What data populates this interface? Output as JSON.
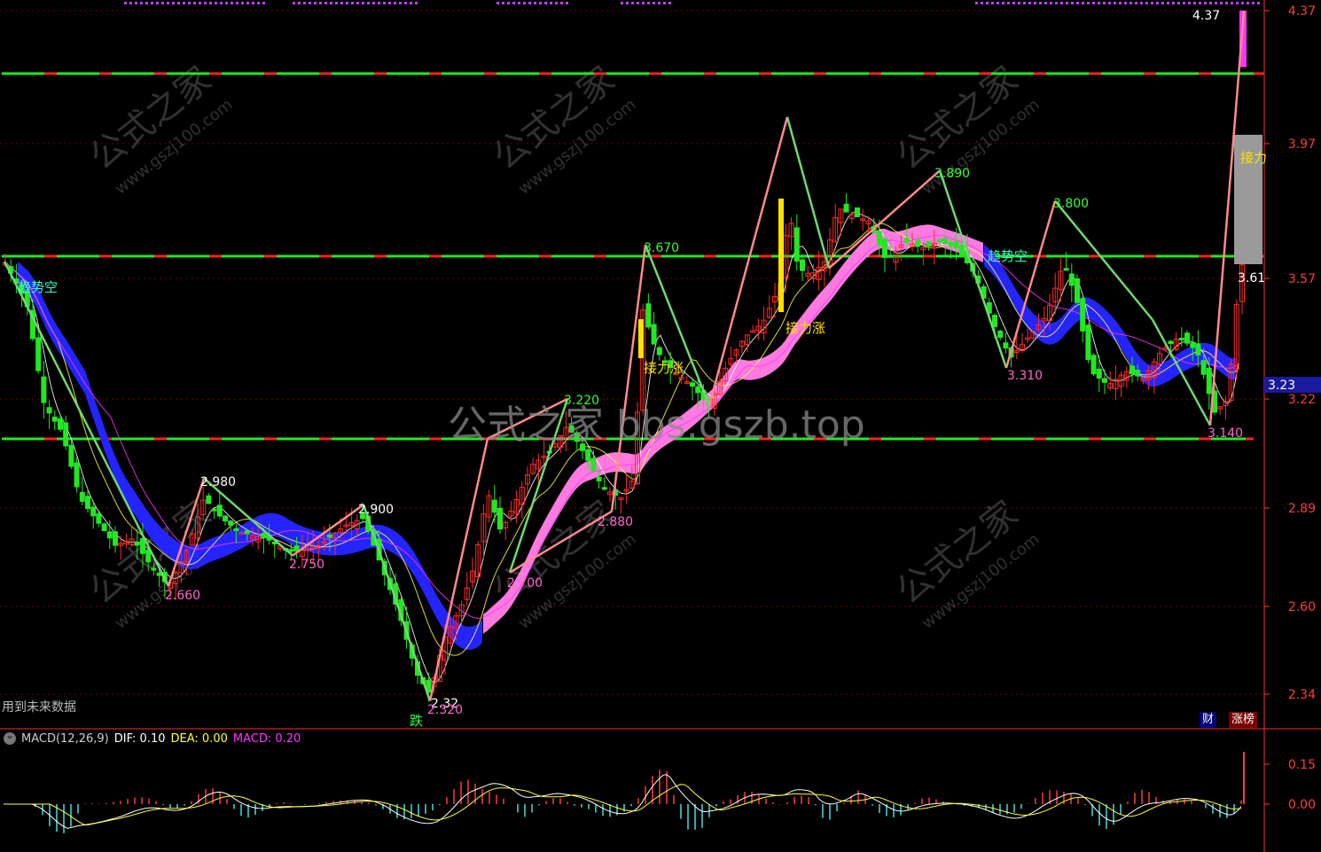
{
  "colors": {
    "up": "#ff2a2a",
    "down": "#22e822",
    "band_down": "#2424ff",
    "band_up": "#ff7ae0",
    "axis": "#ff3b3b",
    "dif": "#ffffff",
    "dea": "#ffff33"
  },
  "chart_data": {
    "type": "candlestick",
    "price_axis": {
      "ticks": [
        "4.37",
        "3.97",
        "3.57",
        "3.22",
        "2.89",
        "2.60",
        "2.34"
      ],
      "current": "3.23",
      "marker": "3.61"
    },
    "peaks": [
      {
        "label": "2.660",
        "price": 2.66
      },
      {
        "label": "2.980",
        "price": 2.98
      },
      {
        "label": "2.750",
        "price": 2.75
      },
      {
        "label": "2.900",
        "price": 2.9
      },
      {
        "label": "2.32",
        "price": 2.32
      },
      {
        "label": "2.320",
        "price": 2.32
      },
      {
        "label": "3.220",
        "price": 3.22
      },
      {
        "label": "2.700",
        "price": 2.7
      },
      {
        "label": "2.880",
        "price": 2.88
      },
      {
        "label": "3.670",
        "price": 3.67
      },
      {
        "label": "3.890",
        "price": 3.89
      },
      {
        "label": "3.800",
        "price": 3.8
      },
      {
        "label": "3.310",
        "price": 3.31
      },
      {
        "label": "3.140",
        "price": 3.14
      },
      {
        "label": "4.37",
        "price": 4.37
      }
    ],
    "signals": [
      {
        "label": "趋势空"
      },
      {
        "label": "接力涨"
      },
      {
        "label": "接力涨"
      },
      {
        "label": "趋势空"
      },
      {
        "label": "跌"
      },
      {
        "label": "接力"
      }
    ],
    "macd": {
      "title": "MACD(12,26,9)",
      "dif_label": "DIF: 0.10",
      "dea_label": "DEA: 0.00",
      "macd_label": "MACD: 0.20",
      "ticks": [
        "0.15",
        "0.00"
      ]
    }
  },
  "overlay": {
    "watermark_center": "公式之家 bbs.gszb.top",
    "watermark_site": "www.gszj100.com",
    "watermark_brand": "公式之家",
    "note": "用到未来数据",
    "badge_cai": "财",
    "badge_zhangbang": "涨榜"
  }
}
